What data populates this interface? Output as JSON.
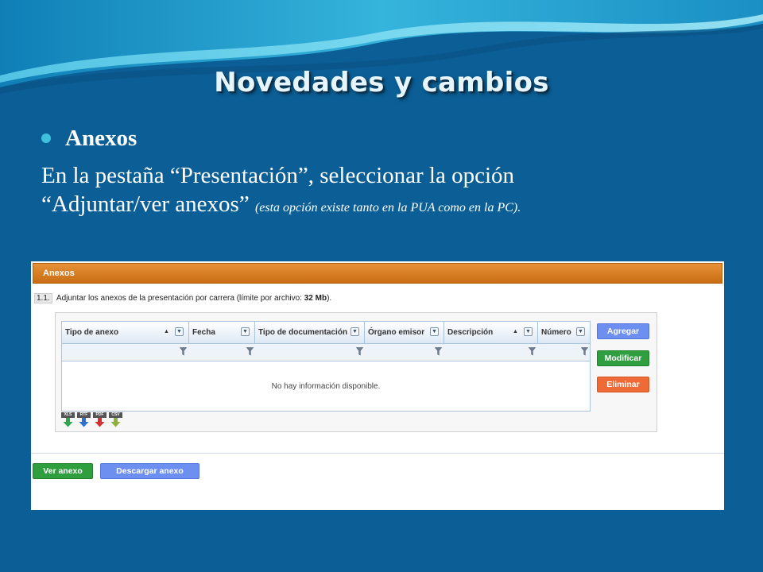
{
  "slide": {
    "title": "Novedades y cambios",
    "bullet": "Anexos",
    "body_line1": "En la pestaña “Presentación”, seleccionar la opción",
    "body_line2": "“Adjuntar/ver anexos”",
    "body_note": "(esta opción existe tanto en la PUA como en la PC)."
  },
  "ui": {
    "panel_title": "Anexos",
    "instruction_num": "1.1.",
    "instruction_text": "Adjuntar los anexos de la presentación por carrera (límite por archivo:",
    "instruction_limit": "32 Mb",
    "instruction_end": ").",
    "grid": {
      "columns": [
        {
          "label": "Tipo de anexo"
        },
        {
          "label": "Fecha"
        },
        {
          "label": "Tipo de documentación"
        },
        {
          "label": "Órgano emisor"
        },
        {
          "label": "Descripción"
        },
        {
          "label": "Número"
        }
      ],
      "empty_message": "No hay información disponible."
    },
    "export": [
      "XLS",
      "RTF",
      "PDF",
      "CSV"
    ],
    "side_buttons": {
      "add": "Agregar",
      "edit": "Modificar",
      "delete": "Eliminar"
    },
    "bottom_buttons": {
      "view": "Ver anexo",
      "download": "Descargar anexo"
    }
  },
  "colors": {
    "slide_bg": "#0b5f96",
    "panel_header": "#d97a1e",
    "btn_blue": "#6d8ff0",
    "btn_green": "#2f9e3f",
    "btn_orange": "#ee6a37"
  }
}
